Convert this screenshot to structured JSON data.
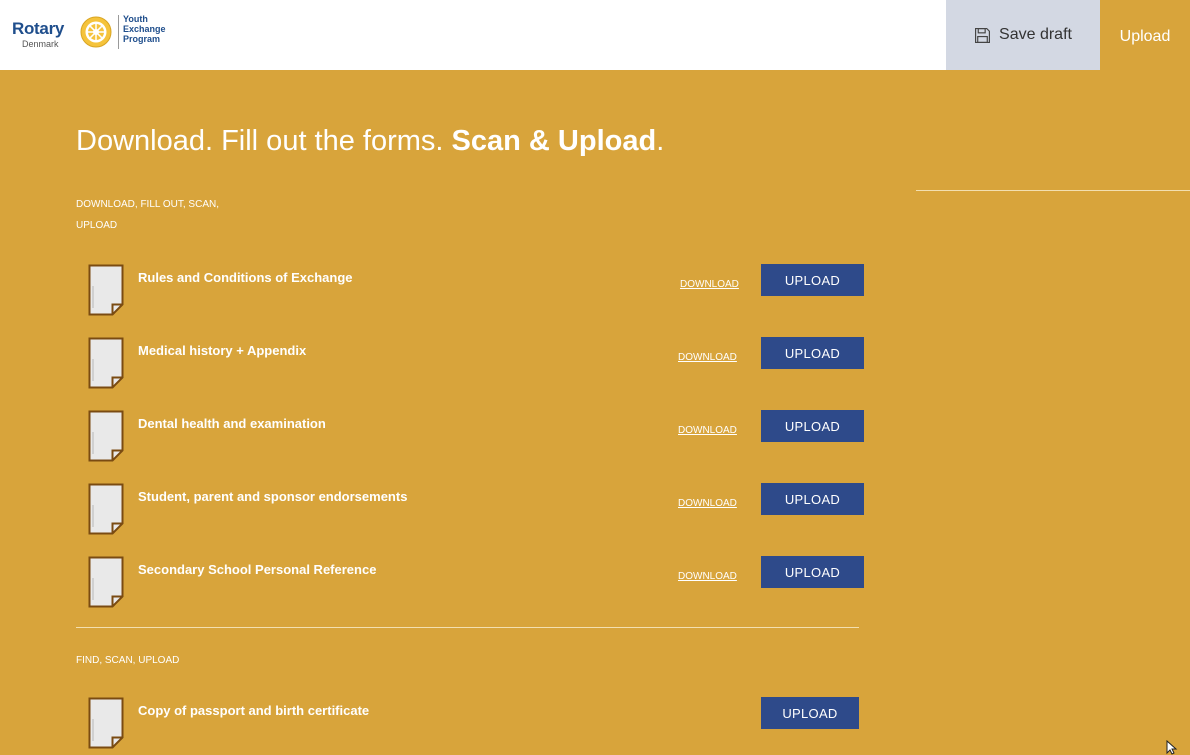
{
  "header": {
    "logo_rotary": "Rotary",
    "logo_country": "Denmark",
    "logo_program": "Youth\nExchange\nProgram",
    "save_draft_label": "Save draft",
    "upload_tab_label": "Upload"
  },
  "main": {
    "title_regular": "Download. Fill out the forms. ",
    "title_bold": "Scan & Upload",
    "title_end": ".",
    "section1_label_line1": "DOWNLOAD, FILL OUT, SCAN,",
    "section1_label_line2": "UPLOAD",
    "section2_label": "FIND, SCAN, UPLOAD",
    "download_label": "DOWNLOAD",
    "upload_label": "UPLOAD",
    "documents": [
      {
        "name": "Rules and Conditions of Exchange"
      },
      {
        "name": "Medical history + Appendix"
      },
      {
        "name": "Dental health and examination"
      },
      {
        "name": "Student, parent and sponsor endorsements"
      },
      {
        "name": "Secondary School Personal Reference"
      }
    ],
    "find_documents": [
      {
        "name": "Copy of passport and birth certificate"
      }
    ]
  },
  "colors": {
    "background": "#d8a43b",
    "upload_button": "#2e4a8a",
    "save_draft_bg": "#d3d8e3",
    "rotary_blue": "#1f4e8c"
  },
  "icons": [
    "rotary-wheel-icon",
    "save-disk-icon",
    "document-icon",
    "mouse-cursor-icon"
  ]
}
